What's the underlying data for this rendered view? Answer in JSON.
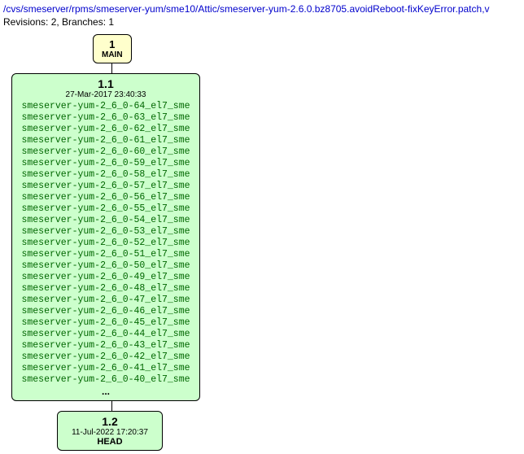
{
  "header": {
    "path": "/cvs/smeserver/rpms/smeserver-yum/sme10/Attic/smeserver-yum-2.6.0.bz8705.avoidReboot-fixKeyError.patch,v",
    "revisions_line": "Revisions: 2, Branches: 1"
  },
  "main_node": {
    "number": "1",
    "label": "MAIN"
  },
  "rev1": {
    "version": "1.1",
    "date": "27-Mar-2017 23:40:33",
    "tags": [
      "smeserver-yum-2_6_0-64_el7_sme",
      "smeserver-yum-2_6_0-63_el7_sme",
      "smeserver-yum-2_6_0-62_el7_sme",
      "smeserver-yum-2_6_0-61_el7_sme",
      "smeserver-yum-2_6_0-60_el7_sme",
      "smeserver-yum-2_6_0-59_el7_sme",
      "smeserver-yum-2_6_0-58_el7_sme",
      "smeserver-yum-2_6_0-57_el7_sme",
      "smeserver-yum-2_6_0-56_el7_sme",
      "smeserver-yum-2_6_0-55_el7_sme",
      "smeserver-yum-2_6_0-54_el7_sme",
      "smeserver-yum-2_6_0-53_el7_sme",
      "smeserver-yum-2_6_0-52_el7_sme",
      "smeserver-yum-2_6_0-51_el7_sme",
      "smeserver-yum-2_6_0-50_el7_sme",
      "smeserver-yum-2_6_0-49_el7_sme",
      "smeserver-yum-2_6_0-48_el7_sme",
      "smeserver-yum-2_6_0-47_el7_sme",
      "smeserver-yum-2_6_0-46_el7_sme",
      "smeserver-yum-2_6_0-45_el7_sme",
      "smeserver-yum-2_6_0-44_el7_sme",
      "smeserver-yum-2_6_0-43_el7_sme",
      "smeserver-yum-2_6_0-42_el7_sme",
      "smeserver-yum-2_6_0-41_el7_sme",
      "smeserver-yum-2_6_0-40_el7_sme"
    ],
    "ellipsis": "..."
  },
  "rev2": {
    "version": "1.2",
    "date": "11-Jul-2022 17:20:37",
    "head": "HEAD"
  }
}
